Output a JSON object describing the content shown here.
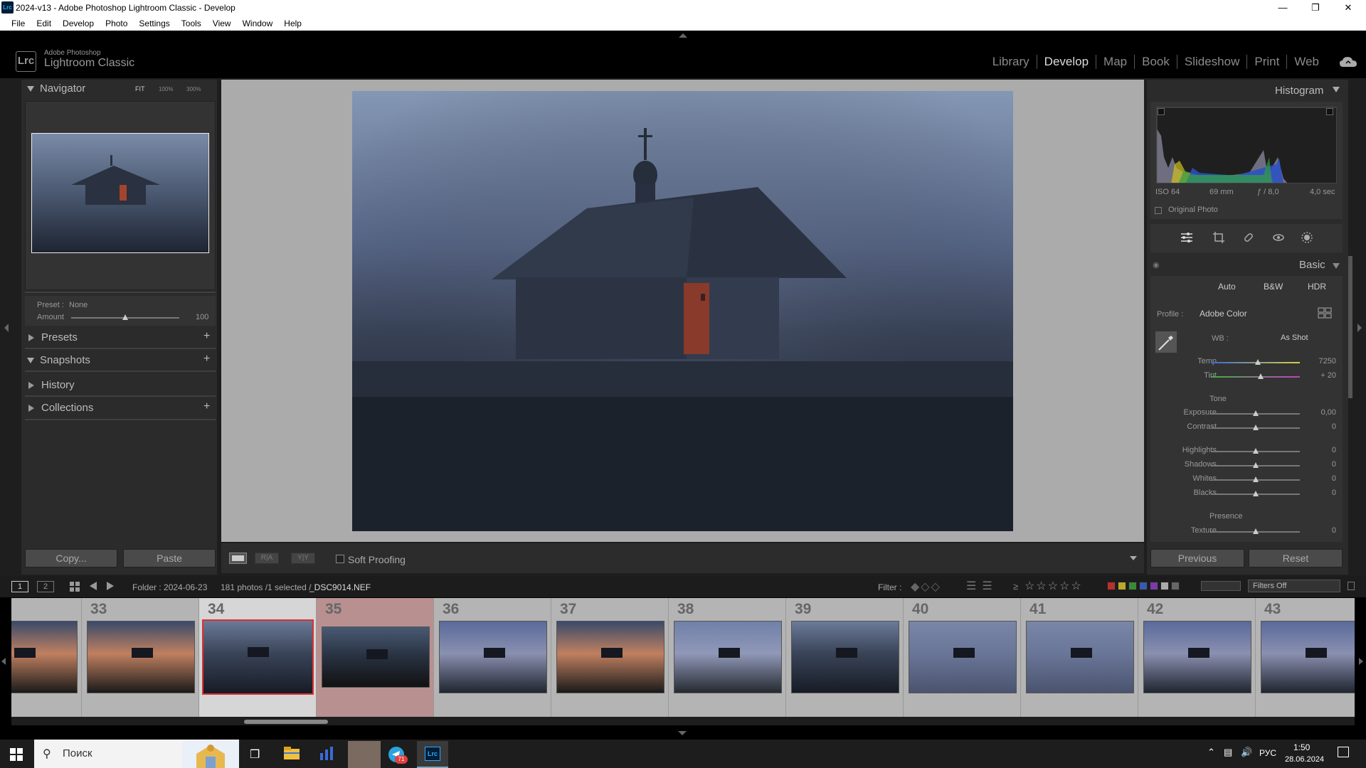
{
  "window": {
    "title": "2024-v13 - Adobe Photoshop Lightroom Classic - Develop",
    "app_icon": "Lrc",
    "controls": [
      "minimize-icon",
      "restore-icon",
      "close-icon"
    ]
  },
  "menu": [
    "File",
    "Edit",
    "Develop",
    "Photo",
    "Settings",
    "Tools",
    "View",
    "Window",
    "Help"
  ],
  "brand": {
    "top": "Adobe Photoshop",
    "bottom": "Lightroom Classic",
    "logo": "Lrc"
  },
  "modules": {
    "items": [
      "Library",
      "Develop",
      "Map",
      "Book",
      "Slideshow",
      "Print",
      "Web"
    ],
    "active": "Develop"
  },
  "left_panel": {
    "navigator": {
      "title": "Navigator",
      "zoom": [
        "FIT",
        "100%",
        "300%"
      ]
    },
    "preset": {
      "label": "Preset :",
      "value": "None",
      "amount_label": "Amount",
      "amount_value": "100",
      "amount_level": 0.5
    },
    "sections": [
      {
        "title": "Presets",
        "expanded": false,
        "add": true
      },
      {
        "title": "Snapshots",
        "expanded": true,
        "add": true
      },
      {
        "title": "History",
        "expanded": false,
        "add": false
      },
      {
        "title": "Collections",
        "expanded": false,
        "add": true
      }
    ],
    "copy_label": "Copy...",
    "paste_label": "Paste"
  },
  "toolbar": {
    "soft_proofing": "Soft Proofing",
    "view_modes": [
      "loupe",
      "R|A",
      "Y|Y"
    ]
  },
  "right_panel": {
    "histogram": {
      "title": "Histogram",
      "iso": "ISO 64",
      "focal": "69 mm",
      "aperture": "ƒ / 8,0",
      "shutter": "4,0 sec",
      "original_photo": "Original Photo"
    },
    "basic": {
      "title": "Basic",
      "treatments": [
        "Auto",
        "B&W",
        "HDR"
      ],
      "profile_label": "Profile :",
      "profile_value": "Adobe Color",
      "wb_label": "WB :",
      "wb_value": "As Shot",
      "wb_sliders": [
        {
          "label": "Temp",
          "value": "7250",
          "level": 0.53
        },
        {
          "label": "Tint",
          "value": "+ 20",
          "level": 0.56
        }
      ],
      "tone_label": "Tone",
      "tone_sliders": [
        {
          "label": "Exposure",
          "value": "0,00",
          "level": 0.5
        },
        {
          "label": "Contrast",
          "value": "0",
          "level": 0.5
        },
        {
          "label": "Highlights",
          "value": "0",
          "level": 0.5
        },
        {
          "label": "Shadows",
          "value": "0",
          "level": 0.5
        },
        {
          "label": "Whites",
          "value": "0",
          "level": 0.5
        },
        {
          "label": "Blacks",
          "value": "0",
          "level": 0.5
        }
      ],
      "presence_label": "Presence",
      "presence_sliders": [
        {
          "label": "Texture",
          "value": "0",
          "level": 0.5
        }
      ]
    },
    "previous_label": "Previous",
    "reset_label": "Reset"
  },
  "filmstrip_bar": {
    "pages": [
      "1",
      "2"
    ],
    "folder": "Folder : 2024-06-23",
    "count": "181 photos /1 selected /",
    "filename": "_DSC9014.NEF",
    "filter_label": "Filter :",
    "rating_op": "≥",
    "filters_off": "Filters Off",
    "color_labels": [
      "#b83030",
      "#b8a830",
      "#3a8a3a",
      "#3a5aa8",
      "#7a3aa8",
      "#aaaaaa",
      "#666666"
    ]
  },
  "filmstrip": {
    "items": [
      {
        "num": "",
        "scene": "sunset"
      },
      {
        "num": "33",
        "scene": "sunset"
      },
      {
        "num": "34",
        "scene": "fog-blue",
        "selected": true
      },
      {
        "num": "35",
        "scene": "fog-dark",
        "highlight": true
      },
      {
        "num": "36",
        "scene": "dawn"
      },
      {
        "num": "37",
        "scene": "sunset"
      },
      {
        "num": "38",
        "scene": "dawn-wide"
      },
      {
        "num": "39",
        "scene": "fog-blue"
      },
      {
        "num": "40",
        "scene": "fog-pale"
      },
      {
        "num": "41",
        "scene": "fog-pale"
      },
      {
        "num": "42",
        "scene": "dawn"
      },
      {
        "num": "43",
        "scene": "dawn"
      }
    ]
  },
  "taskbar": {
    "search_placeholder": "Поиск",
    "lang": "РУС",
    "time": "1:50",
    "date": "28.06.2024",
    "telegram_badge": "71"
  }
}
